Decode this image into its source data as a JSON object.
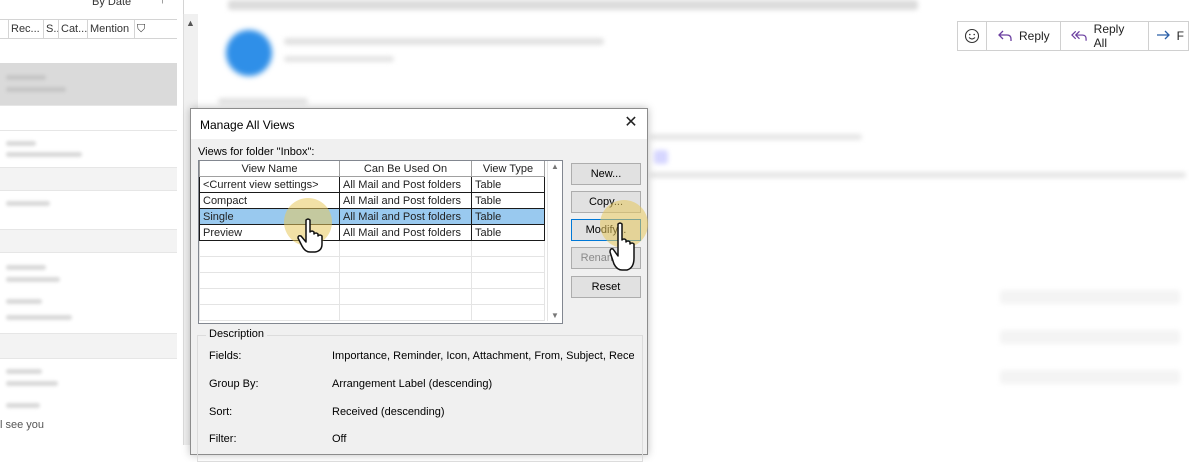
{
  "message_list": {
    "sort_label": "By Date",
    "columns": [
      "Rec...",
      "S...",
      "Cat...",
      "Mention"
    ],
    "snippet_visible": "l see you"
  },
  "toolbar": {
    "emoji_icon": "smiley-icon",
    "reply_label": "Reply",
    "reply_all_label": "Reply All",
    "forward_label": "F"
  },
  "dialog": {
    "title": "Manage All Views",
    "views_for_label": "Views for folder \"Inbox\":",
    "columns": [
      "View Name",
      "Can Be Used On",
      "View Type"
    ],
    "rows": [
      {
        "name": "<Current view settings>",
        "used_on": "All Mail and Post folders",
        "type": "Table"
      },
      {
        "name": "Compact",
        "used_on": "All Mail and Post folders",
        "type": "Table"
      },
      {
        "name": "Single",
        "used_on": "All Mail and Post folders",
        "type": "Table"
      },
      {
        "name": "Preview",
        "used_on": "All Mail and Post folders",
        "type": "Table"
      }
    ],
    "selected_row": "Single",
    "buttons": {
      "new": "New...",
      "copy": "Copy...",
      "modify": "Modify...",
      "rename": "Rename...",
      "reset": "Reset"
    },
    "description": {
      "legend": "Description",
      "fields_label": "Fields:",
      "fields_value": "Importance, Reminder, Icon, Attachment, From, Subject, Recei",
      "group_label": "Group By:",
      "group_value": "Arrangement Label (descending)",
      "sort_label": "Sort:",
      "sort_value": "Received (descending)",
      "filter_label": "Filter:",
      "filter_value": "Off"
    }
  },
  "colors": {
    "selection": "#99c9ef",
    "accent": "#0078d7",
    "highlight": "#e8c85c"
  }
}
